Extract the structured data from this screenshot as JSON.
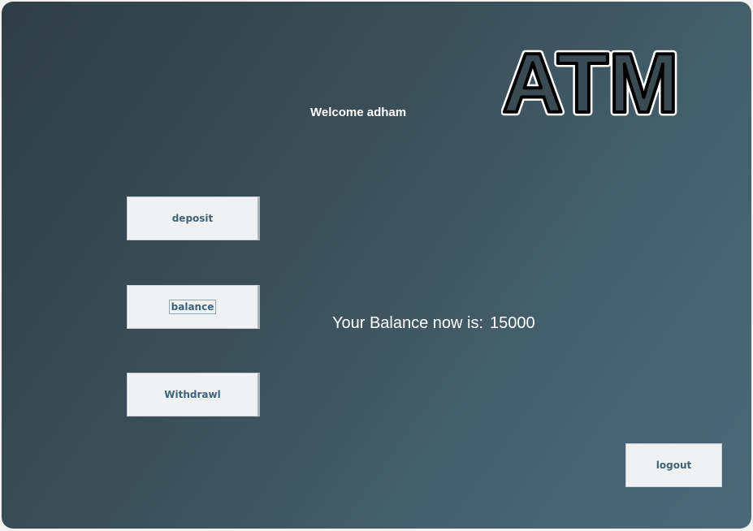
{
  "logo": {
    "text": "ATM"
  },
  "header": {
    "welcome": "Welcome adham"
  },
  "menu": {
    "deposit_label": "deposit",
    "balance_label": "balance",
    "withdraw_label": "Withdrawl"
  },
  "balance": {
    "label": "Your Balance now is:",
    "amount": "15000"
  },
  "footer": {
    "logout_label": "logout"
  },
  "colors": {
    "background_start": "#2f3e46",
    "background_end": "#4a6978",
    "button_bg": "#eff1f2",
    "button_text": "#3f6378"
  }
}
